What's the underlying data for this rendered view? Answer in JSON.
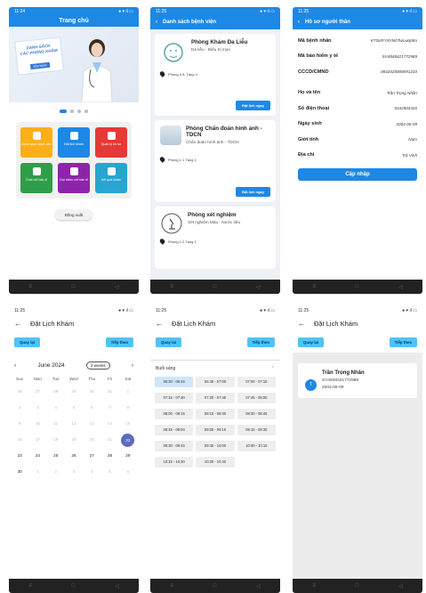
{
  "status": {
    "s1": "11:24",
    "s2": "11:25",
    "s3": "11:25",
    "s4": "11:25",
    "s5": "11:25",
    "s6": "11:25"
  },
  "home": {
    "title": "Trang chủ",
    "banner_line1": "DANH SÁCH",
    "banner_line2": "CÁC PHÒNG KHÁM",
    "banner_tag": "XEM NGAY",
    "tiles": [
      {
        "label": "Danh sách bệnh viện",
        "color": "#fbb017"
      },
      {
        "label": "Đặt lịch khám",
        "color": "#1e88e5"
      },
      {
        "label": "Quản lý hồ sơ",
        "color": "#e53935"
      },
      {
        "label": "Chat với bác sĩ",
        "color": "#2e9e48"
      },
      {
        "label": "Gọi video với bác sĩ",
        "color": "#8e24aa"
      },
      {
        "label": "Kết quả khám",
        "color": "#26a6d1"
      }
    ],
    "logout": "Đăng xuất"
  },
  "hospitals": {
    "title": "Danh sách bệnh viện",
    "items": [
      {
        "name": "Phòng Khám Da Liễu",
        "desc": "Da liễu - Điều trị mụn",
        "loc": "Phòng 4.5, Tầng 4",
        "btn": "Đặt lịch ngay"
      },
      {
        "name": "Phòng Chẩn đoán hình ảnh - TDCN",
        "desc": "Chẩn đoán hình ảnh - TDCN",
        "loc": "Phòng 1.1 Tầng 1",
        "btn": "Đặt lịch ngay"
      },
      {
        "name": "Phòng xét nghiệm",
        "desc": "Xét nghiệm Máu - Nước tiểu",
        "loc": "Phòng 1.2 Tầng 1",
        "btn": "Đặt lịch ngay"
      }
    ]
  },
  "profile": {
    "title": "Hồ sơ người thân",
    "rows": [
      {
        "label": "Mã bệnh nhân",
        "value": "K73xRrY8YlnbTwLwqr8m"
      },
      {
        "label": "Mã bảo hiểm y tế",
        "value": "SV4848421772989"
      },
      {
        "label": "CCCD/CMND",
        "value": "0842020008091234"
      },
      {
        "label": "Họ và tên",
        "value": "Trần Trọng Nhân"
      },
      {
        "label": "Số điện thoại",
        "value": "0342903416"
      },
      {
        "label": "Ngày sinh",
        "value": "2002-06-09"
      },
      {
        "label": "Giới tính",
        "value": "Nam"
      },
      {
        "label": "Địa chỉ",
        "value": "Trà Vinh"
      }
    ],
    "update": "Cập nhập"
  },
  "booking": {
    "title": "Đặt Lịch Khám",
    "back": "Quay lại",
    "next": "Tiếp theo",
    "month": "June 2024",
    "mode": "2 weeks",
    "dows": [
      "Sun",
      "Mon",
      "Tue",
      "Wed",
      "Thu",
      "Fri",
      "Sat"
    ],
    "days": [
      {
        "d": "26",
        "m": 1
      },
      {
        "d": "27",
        "m": 1
      },
      {
        "d": "28",
        "m": 1
      },
      {
        "d": "29",
        "m": 1
      },
      {
        "d": "30",
        "m": 1
      },
      {
        "d": "31",
        "m": 1
      },
      {
        "d": "1",
        "m": 1
      },
      {
        "d": "2",
        "m": 1
      },
      {
        "d": "3",
        "m": 1
      },
      {
        "d": "4",
        "m": 1
      },
      {
        "d": "5",
        "m": 1
      },
      {
        "d": "6",
        "m": 1
      },
      {
        "d": "7",
        "m": 1
      },
      {
        "d": "8",
        "m": 1
      },
      {
        "d": "9",
        "m": 1
      },
      {
        "d": "10",
        "m": 1
      },
      {
        "d": "11",
        "m": 1
      },
      {
        "d": "12",
        "m": 1
      },
      {
        "d": "13",
        "m": 1
      },
      {
        "d": "14",
        "m": 1
      },
      {
        "d": "15",
        "m": 1
      },
      {
        "d": "16",
        "m": 1
      },
      {
        "d": "17",
        "m": 1
      },
      {
        "d": "18",
        "m": 1
      },
      {
        "d": "19",
        "m": 1
      },
      {
        "d": "20",
        "m": 1
      },
      {
        "d": "21",
        "m": 1
      },
      {
        "d": "22",
        "m": 0,
        "sel": 1
      },
      {
        "d": "23",
        "m": 0
      },
      {
        "d": "24",
        "m": 0
      },
      {
        "d": "25",
        "m": 0
      },
      {
        "d": "26",
        "m": 0
      },
      {
        "d": "27",
        "m": 0
      },
      {
        "d": "28",
        "m": 0
      },
      {
        "d": "29",
        "m": 0
      },
      {
        "d": "30",
        "m": 0
      },
      {
        "d": "1",
        "m": 1
      },
      {
        "d": "2",
        "m": 1
      },
      {
        "d": "3",
        "m": 1
      },
      {
        "d": "4",
        "m": 1
      },
      {
        "d": "5",
        "m": 1
      },
      {
        "d": "6",
        "m": 1
      }
    ],
    "session": "Buổi sáng",
    "slots": [
      "06:30 - 06:45",
      "06:45 - 07:00",
      "07:00 - 07:15",
      "07:15 - 07:30",
      "07:30 - 07:45",
      "07:45 - 08:00",
      "08:00 - 08:15",
      "08:15 - 08:30",
      "08:30 - 08:45",
      "08:45 - 09:00",
      "09:00 - 09:15",
      "09:15 - 09:30",
      "09:30 - 09:45",
      "09:45 - 10:00",
      "10:00 - 10:15",
      "10:15 - 10:30",
      "10:30 - 10:40"
    ],
    "patient": {
      "initial": "T",
      "name": "Trần Trọng Nhân",
      "insurance": "SV4848421772989",
      "dob": "2002-06-09"
    }
  }
}
